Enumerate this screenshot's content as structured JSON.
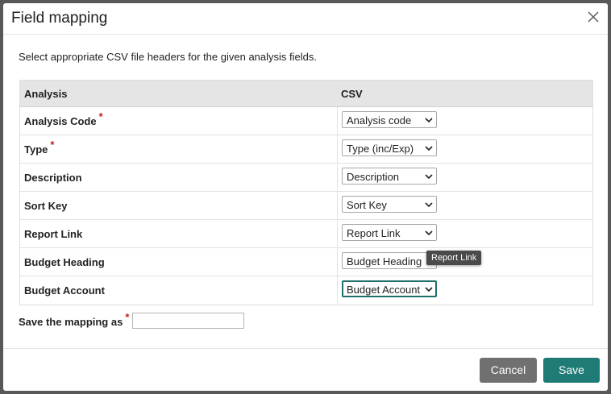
{
  "dialog": {
    "title": "Field mapping",
    "close_icon": "close-icon"
  },
  "intro_text": "Select appropriate CSV file headers for the given analysis fields.",
  "table": {
    "headers": {
      "analysis": "Analysis",
      "csv": "CSV"
    },
    "rows": [
      {
        "label": "Analysis Code",
        "required": true,
        "selected": "Analysis code"
      },
      {
        "label": "Type",
        "required": true,
        "selected": "Type (inc/Exp)"
      },
      {
        "label": "Description",
        "required": false,
        "selected": "Description"
      },
      {
        "label": "Sort Key",
        "required": false,
        "selected": "Sort Key"
      },
      {
        "label": "Report Link",
        "required": false,
        "selected": "Report Link"
      },
      {
        "label": "Budget Heading",
        "required": false,
        "selected": "Budget Heading"
      },
      {
        "label": "Budget Account",
        "required": false,
        "selected": "Budget Account"
      }
    ],
    "required_marker": "*"
  },
  "tooltip": "Report Link",
  "save_as": {
    "label": "Save the mapping as",
    "required_marker": "*",
    "value": ""
  },
  "footer": {
    "cancel_label": "Cancel",
    "save_label": "Save"
  },
  "colors": {
    "primary": "#1f7b75",
    "secondary": "#707070",
    "required": "#c41e1e",
    "focus": "#1f6f6b"
  }
}
